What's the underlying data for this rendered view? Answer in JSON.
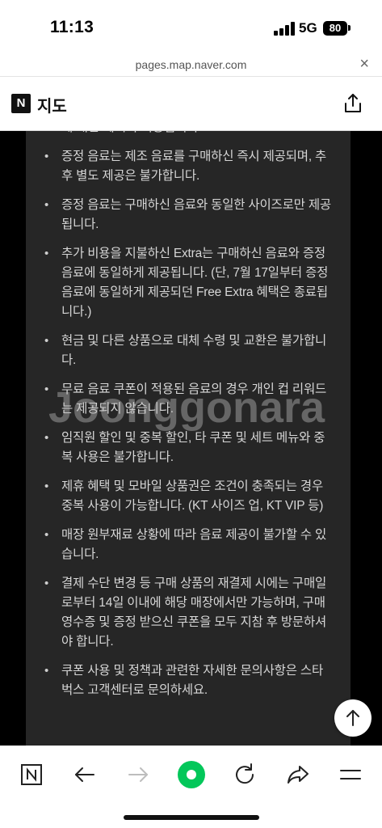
{
  "status_bar": {
    "time": "11:13",
    "network": "5G",
    "battery": "80"
  },
  "url_bar": {
    "url": "pages.map.naver.com",
    "close_icon": "close-icon"
  },
  "header": {
    "logo": "N",
    "title": "지도",
    "share_icon": "share-icon"
  },
  "notices": {
    "cutoff_text": "에 대한 혜택이 적용됩니다.",
    "items": [
      "증정 음료는 제조 음료를 구매하신 즉시 제공되며, 추후 별도 제공은 불가합니다.",
      "증정 음료는 구매하신 음료와 동일한 사이즈로만 제공됩니다.",
      "추가 비용을 지불하신 Extra는 구매하신 음료와 증정 음료에 동일하게 제공됩니다. (단, 7월 17일부터 증정 음료에 동일하게 제공되던 Free Extra 혜택은 종료됩니다.)",
      "현금 및 다른 상품으로 대체 수령 및 교환은 불가합니다.",
      "무료 음료 쿠폰이 적용된 음료의 경우 개인 컵 리워드는 제공되지 않습니다.",
      "임직원 할인 및 중복 할인, 타 쿠폰 및 세트 메뉴와 중복 사용은 불가합니다.",
      "제휴 혜택 및 모바일 상품권은 조건이 충족되는 경우 중복 사용이 가능합니다. (KT 사이즈 업, KT VIP 등)",
      "매장 원부재료 상황에 따라 음료 제공이 불가할 수 있습니다.",
      "결제 수단 변경 등 구매 상품의 재결제 시에는 구매일로부터 14일 이내에 해당 매장에서만 가능하며, 구매 영수증 및 증정 받으신 쿠폰을 모두 지참 후 방문하셔야 합니다.",
      "쿠폰 사용 및 정책과 관련한 자세한 문의사항은 스타벅스 고객센터로 문의하세요."
    ]
  },
  "watermark": "Joonggonara",
  "bottom_nav": {
    "items": [
      "naver-home-icon",
      "back-arrow-icon",
      "forward-arrow-icon",
      "green-dot-icon",
      "reload-icon",
      "share-arrow-icon",
      "menu-icon"
    ],
    "accent_color": "#03c75a"
  },
  "scroll_top_icon": "arrow-up-icon"
}
